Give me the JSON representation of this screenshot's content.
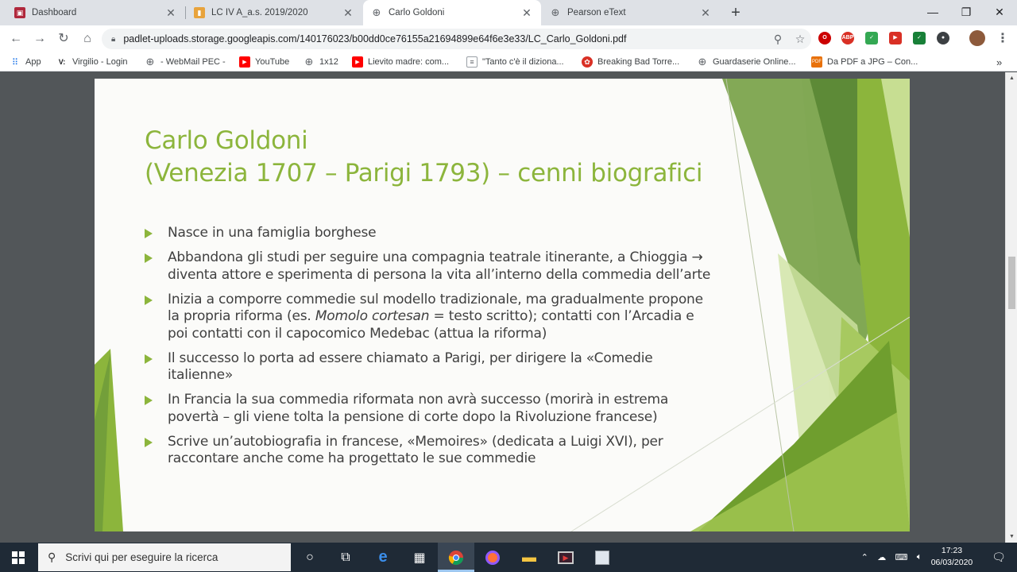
{
  "browser": {
    "tabs": [
      {
        "title": "Dashboard",
        "icon": "dashboard-favicon",
        "color": "#b0283c"
      },
      {
        "title": "LC IV A_a.s. 2019/2020",
        "icon": "padlet-favicon",
        "color": "#e8a33c"
      },
      {
        "title": "Carlo Goldoni",
        "icon": "globe-favicon",
        "color": "#5f6368",
        "active": true
      },
      {
        "title": "Pearson eText",
        "icon": "globe-favicon",
        "color": "#5f6368"
      }
    ],
    "url": "padlet-uploads.storage.googleapis.com/140176023/b00dd0ce76155a21694899e64f6e3e33/LC_Carlo_Goldoni.pdf",
    "bookmarks": [
      {
        "label": "App",
        "icon": "apps-icon"
      },
      {
        "label": "Virgilio - Login",
        "icon": "virgilio-icon"
      },
      {
        "label": "- WebMail PEC -",
        "icon": "globe-icon"
      },
      {
        "label": "YouTube",
        "icon": "youtube-icon"
      },
      {
        "label": "1x12",
        "icon": "globe-icon"
      },
      {
        "label": "Lievito madre: com...",
        "icon": "youtube-icon"
      },
      {
        "label": "\"Tanto c'è il diziona...",
        "icon": "doc-icon"
      },
      {
        "label": "Breaking Bad Torre...",
        "icon": "torrent-icon"
      },
      {
        "label": "Guardaserie Online...",
        "icon": "globe-icon"
      },
      {
        "label": "Da PDF a JPG – Con...",
        "icon": "pdf-icon"
      }
    ],
    "bookmarks_more": "»"
  },
  "slide": {
    "title_line1": "Carlo Goldoni",
    "title_line2": "(Venezia 1707 – Parigi 1793) – cenni biografici",
    "bullets": [
      {
        "text": "Nasce in una famiglia borghese"
      },
      {
        "text": "Abbandona gli studi per seguire una compagnia teatrale itinerante, a Chioggia → diventa attore e sperimenta di persona la vita all’interno della commedia dell’arte"
      },
      {
        "text_before": "Inizia a comporre commedie sul modello tradizionale, ma gradualmente propone la propria riforma (es. ",
        "text_italic": "Momolo cortesan",
        "text_after": " = testo scritto); contatti con l’Arcadia e poi contatti con il capocomico Medebac (attua la riforma)"
      },
      {
        "text": "Il successo lo porta ad essere chiamato a Parigi, per dirigere la «Comedie italienne»"
      },
      {
        "text": "In Francia la sua commedia riformata non avrà successo (morirà in estrema povertà – gli viene tolta la pensione di corte dopo la Rivoluzione francese)"
      },
      {
        "text": "Scrive un’autobiografia in francese, «Memoires» (dedicata a Luigi XVI), per raccontare anche come ha progettato le sue commedie"
      }
    ],
    "accent_color": "#8cb53c"
  },
  "taskbar": {
    "search_placeholder": "Scrivi qui per eseguire la ricerca",
    "time": "17:23",
    "date": "06/03/2020"
  }
}
